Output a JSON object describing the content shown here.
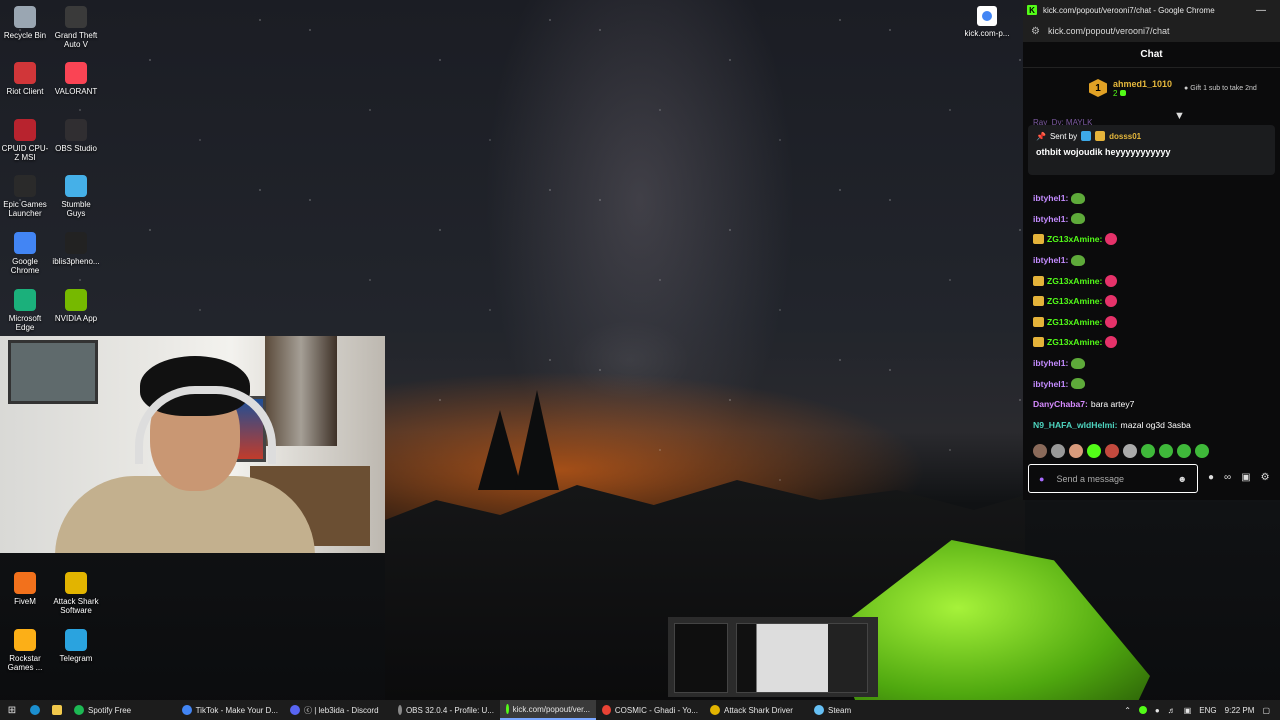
{
  "desktop": {
    "icons": [
      {
        "label": "Recycle Bin",
        "icon": "recycle-bin-icon",
        "color": "#9aa6b2"
      },
      {
        "label": "Grand Theft Auto V",
        "icon": "gta-icon",
        "color": "#3a3a3a"
      },
      {
        "label": "Riot Client",
        "icon": "riot-icon",
        "color": "#d13639"
      },
      {
        "label": "VALORANT",
        "icon": "valorant-icon",
        "color": "#fa4454"
      },
      {
        "label": "CPUID CPU-Z MSI",
        "icon": "cpuz-icon",
        "color": "#b8232e"
      },
      {
        "label": "OBS Studio",
        "icon": "obs-icon",
        "color": "#302e31"
      },
      {
        "label": "Epic Games Launcher",
        "icon": "epic-icon",
        "color": "#2a2a2a"
      },
      {
        "label": "Stumble Guys",
        "icon": "stumble-icon",
        "color": "#45b0e8"
      },
      {
        "label": "Google Chrome",
        "icon": "chrome-icon",
        "color": "#4285f4"
      },
      {
        "label": "iblis3pheno...",
        "icon": "file-icon",
        "color": "#222222"
      },
      {
        "label": "Microsoft Edge",
        "icon": "edge-icon",
        "color": "#1bb07b"
      },
      {
        "label": "NVIDIA App",
        "icon": "nvidia-icon",
        "color": "#76b900"
      },
      {
        "label": "FiveM",
        "icon": "fivem-icon",
        "color": "#f2711c"
      },
      {
        "label": "Attack Shark Software",
        "icon": "attack-shark-icon",
        "color": "#e2b400"
      },
      {
        "label": "Rockstar Games ...",
        "icon": "rockstar-icon",
        "color": "#fcaf17"
      },
      {
        "label": "Telegram",
        "icon": "telegram-icon",
        "color": "#2aa3df"
      }
    ],
    "kick_shortcut": "kick.com-p..."
  },
  "browser": {
    "title": "kick.com/popout/verooni7/chat - Google Chrome",
    "url": "kick.com/popout/verooni7/chat",
    "chat_title": "Chat",
    "leaderboard": {
      "rank": "1",
      "username": "ahmed1_1010",
      "count": "2",
      "gift_text": "Gift 1 sub to take 2nd"
    },
    "cut_off_line": "Ray_Dy: MAYLK",
    "pinned": {
      "sent_by_label": "Sent by",
      "sent_by_user": "dosss01",
      "message": "othbit wojoudik heyyyyyyyyyyy"
    },
    "messages": [
      {
        "user": "ibtyhel1:",
        "text": "",
        "badge": "",
        "emote": "frog",
        "color": "purple"
      },
      {
        "user": "ibtyhel1:",
        "text": "",
        "badge": "",
        "emote": "frog",
        "color": "purple"
      },
      {
        "user": "ZG13xAmine:",
        "text": "",
        "badge": "crown",
        "emote": "pink",
        "color": "green"
      },
      {
        "user": "ibtyhel1:",
        "text": "",
        "badge": "",
        "emote": "frog",
        "color": "purple"
      },
      {
        "user": "ZG13xAmine:",
        "text": "",
        "badge": "crown",
        "emote": "pink",
        "color": "green"
      },
      {
        "user": "ZG13xAmine:",
        "text": "",
        "badge": "crown",
        "emote": "pink",
        "color": "green"
      },
      {
        "user": "ZG13xAmine:",
        "text": "",
        "badge": "crown",
        "emote": "pink",
        "color": "green"
      },
      {
        "user": "ZG13xAmine:",
        "text": "",
        "badge": "crown",
        "emote": "pink",
        "color": "green"
      },
      {
        "user": "ibtyhel1:",
        "text": "",
        "badge": "",
        "emote": "frog",
        "color": "purple"
      },
      {
        "user": "ibtyhel1:",
        "text": "",
        "badge": "",
        "emote": "frog",
        "color": "purple"
      },
      {
        "user": "DanyChaba7:",
        "text": "bara artey7",
        "badge": "",
        "emote": "",
        "color": "pink"
      },
      {
        "user": "N9_HAFA_wldHelmi:",
        "text": "mazal og3d 3asba",
        "badge": "",
        "emote": "",
        "color": "teal"
      }
    ],
    "input_placeholder": "Send a message"
  },
  "taskbar": {
    "items": [
      {
        "label": "Spotify Free",
        "icon": "spotify-icon",
        "color": "#1db954"
      },
      {
        "label": "TikTok - Make Your D...",
        "icon": "chrome-icon",
        "color": "#4285f4"
      },
      {
        "label": "ⓒ | leb3ida - Discord",
        "icon": "discord-icon",
        "color": "#5865f2"
      },
      {
        "label": "OBS 32.0.4 - Profile: U...",
        "icon": "obs-icon",
        "color": "#888888"
      },
      {
        "label": "kick.com/popout/ver...",
        "icon": "kick-icon",
        "color": "#53fc18"
      },
      {
        "label": "COSMIC - Ghadi - Yo...",
        "icon": "chrome-icon",
        "color": "#ea4335"
      },
      {
        "label": "Attack Shark Driver",
        "icon": "attack-shark-icon",
        "color": "#e2b400"
      },
      {
        "label": "Steam",
        "icon": "steam-icon",
        "color": "#66c0f4"
      }
    ],
    "lang": "ENG",
    "time": "9:22 PM"
  }
}
